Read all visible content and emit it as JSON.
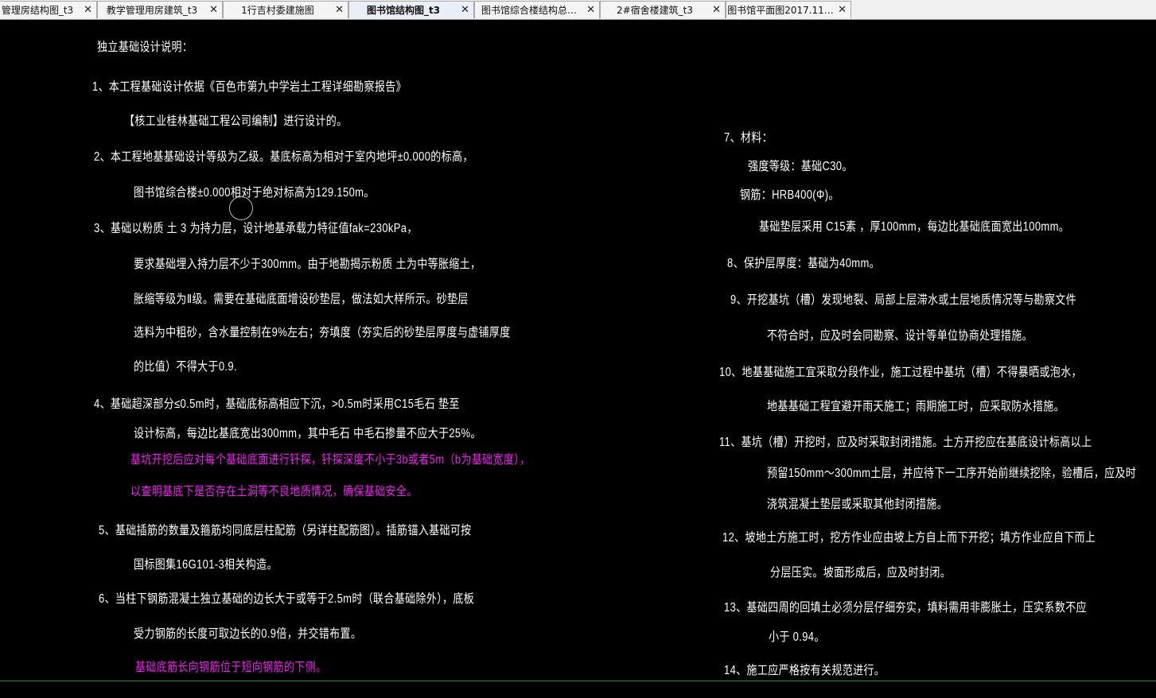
{
  "tabs": [
    {
      "label": "管理房结构图_t3",
      "close": "✕"
    },
    {
      "label": "教学管理用房建筑_t3",
      "close": "✕"
    },
    {
      "label": "1行吉村委建施图",
      "close": "✕"
    },
    {
      "label": "图书馆结构图_t3",
      "close": "✕",
      "active": true
    },
    {
      "label": "图书馆综合楼结构总…",
      "close": "✕"
    },
    {
      "label": "2#宿舍楼建筑_t3",
      "close": "✕"
    },
    {
      "label": "图书馆平面图2017.11…",
      "close": "✕"
    }
  ],
  "drawing": {
    "text_color": "#ffffff",
    "highlight_color": "#f020f0",
    "left_lines": [
      "独立基础设计说明：",
      "1、本工程基础设计依据《百色市第九中学岩土工程详细勘察报告》",
      "【核工业桂林基础工程公司编制】进行设计的。",
      "2、本工程地基基础设计等级为乙级。基底标高为相对于室内地坪±0.000的标高，",
      "图书馆综合楼±0.000相对于绝对标高为129.150m。",
      "3、基础以粉质  土 3  为持力层，设计地基承载力特征值fak=230kPa，",
      "要求基础埋入持力层不少于300mm。由于地勘揭示粉质  土为中等胀缩土，",
      "胀缩等级为Ⅱ级。需要在基础底面增设砂垫层，做法如大样所示。砂垫层",
      "选料为中粗砂，含水量控制在9%左右；夯填度（夯实后的砂垫层厚度与虚铺厚度",
      "的比值）不得大于0.9.",
      "4、基础超深部分≤0.5m时，基础底标高相应下沉，>0.5m时采用C15毛石  垫至",
      "设计标高，每边比基底宽出300mm，其中毛石  中毛石掺量不应大于25%。",
      "基坑开挖后应对每个基础底面进行钎探，钎探深度不小于3b或者5m（b为基础宽度），",
      "以查明基底下是否存在土洞等不良地质情况，确保基础安全。",
      "5、基础插筋的数量及箍筋均同底层柱配筋（另详柱配筋图）。插筋锚入基础可按",
      "国标图集16G101-3相关构造。",
      "6、当柱下钢筋混凝土独立基础的边长大于或等于2.5m时（联合基础除外），底板",
      "受力钢筋的长度可取边长的0.9倍，并交错布置。",
      "基础底筋长向钢筋位于短向钢筋的下侧。"
    ],
    "right_lines": [
      "7、材料：",
      "强度等级：基础C30。",
      "钢筋：HRB400(Φ)。",
      "基础垫层采用 C15素  ，厚100mm，每边比基础底面宽出100mm。",
      "8、保护层厚度：基础为40mm。",
      "9、开挖基坑（槽）发现地裂、局部上层滞水或土层地质情况等与勘察文件",
      "不符合时，应及时会同勘察、设计等单位协商处理措施。",
      "10、地基基础施工宜采取分段作业，施工过程中基坑（槽）不得暴晒或泡水，",
      "地基基础工程宜避开雨天施工；雨期施工时，应采取防水措施。",
      "11、基坑（槽）开挖时，应及时采取封闭措施。土方开挖应在基底设计标高以上",
      "预留150mm～300mm土层，并应待下一工序开始前继续挖除，验槽后，应及时",
      "浇筑混凝土垫层或采取其他封闭措施。",
      "12、坡地土方施工时，挖方作业应由坡上方自上而下开挖；填方作业应自下而上",
      "分层压实。坡面形成后，应及时封闭。",
      "13、基础四周的回填土必须分层仔细夯实，填料需用非膨胀土，压实系数不应",
      "小于 0.94。",
      "14、施工应严格按有关规范进行。"
    ]
  }
}
